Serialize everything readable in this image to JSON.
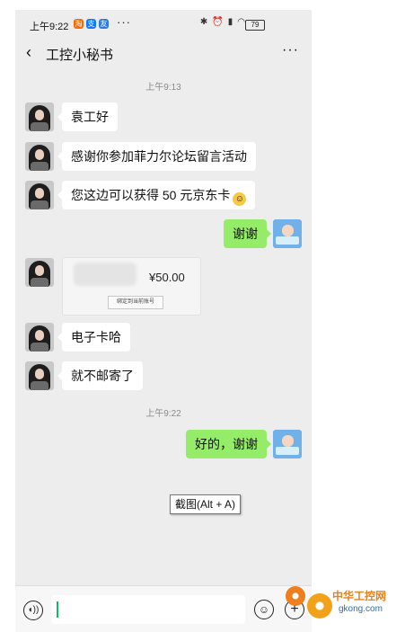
{
  "status_bar": {
    "time": "上午9:22",
    "app_icons": [
      {
        "name": "taobao-icon",
        "color": "#ff6a00",
        "glyph": "淘"
      },
      {
        "name": "alipay-icon",
        "color": "#1677ff",
        "glyph": "支"
      },
      {
        "name": "friends-icon",
        "color": "#2f7be6",
        "glyph": "友"
      }
    ],
    "more": "···",
    "battery": "79"
  },
  "nav": {
    "title": "工控小秘书",
    "more": "···"
  },
  "chat": {
    "timestamps": [
      "上午9:13",
      "上午9:22"
    ],
    "messages": [
      {
        "text": "袁工好"
      },
      {
        "text": "感谢你参加菲力尔论坛留言活动"
      },
      {
        "text": "您这边可以获得 50 元京东卡"
      },
      {
        "text": "谢谢"
      },
      {
        "text": "电子卡哈"
      },
      {
        "text": "就不邮寄了"
      },
      {
        "text": "好的，谢谢"
      }
    ],
    "card": {
      "amount": "¥50.00",
      "button": "绑定到当前账号"
    }
  },
  "tooltip": "截图(Alt + A)",
  "watermark": {
    "brand": "中华工控网",
    "url": "gkong.com"
  },
  "colors": {
    "chat_bg": "#ededed",
    "bubble_out": "#95ec69",
    "bubble_in": "#ffffff",
    "cursor": "#07c160"
  }
}
